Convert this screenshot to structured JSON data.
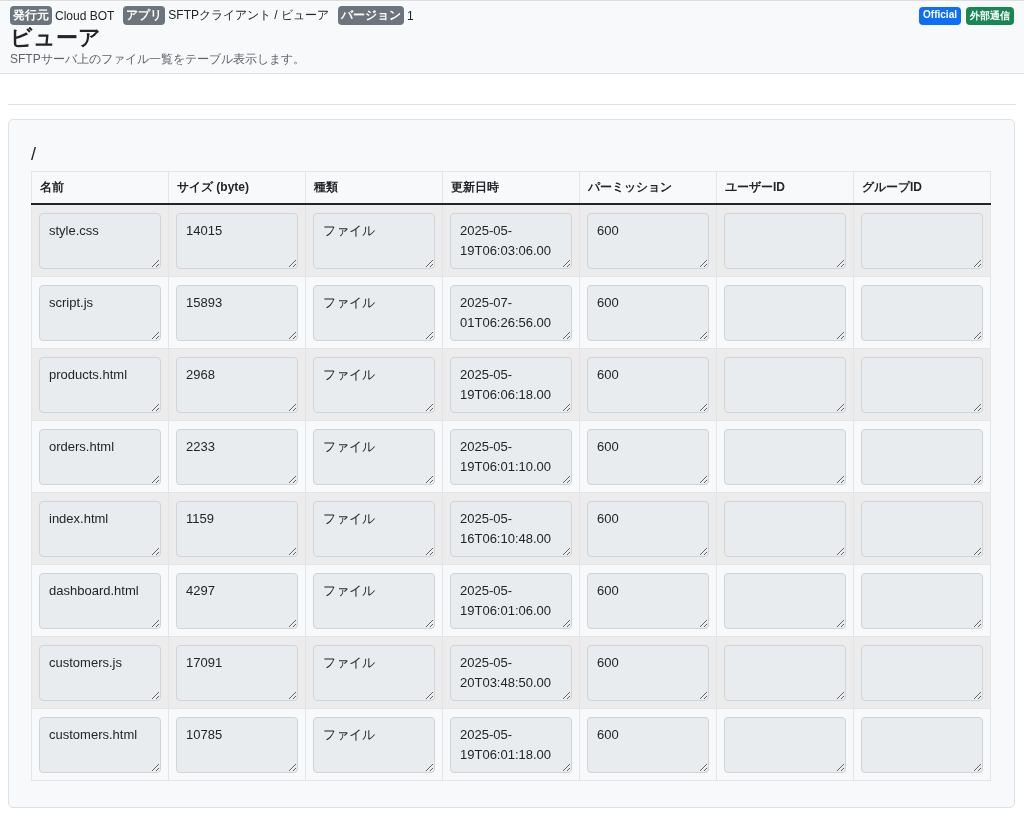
{
  "meta": [
    {
      "badge": "発行元",
      "value": "Cloud BOT"
    },
    {
      "badge": "アプリ",
      "value": "SFTPクライアント / ビューア"
    },
    {
      "badge": "バージョン",
      "value": "1"
    }
  ],
  "tags": [
    {
      "label": "Official",
      "color": "#0d6efd"
    },
    {
      "label": "外部通信",
      "color": "#198754"
    }
  ],
  "title": "ビューア",
  "subtitle": "SFTPサーバ上のファイル一覧をテーブル表示します。",
  "path": "/",
  "table": {
    "columns": [
      "名前",
      "サイズ (byte)",
      "種類",
      "更新日時",
      "パーミッション",
      "ユーザーID",
      "グループID"
    ],
    "rows": [
      {
        "cells": [
          "style.css",
          "14015",
          "ファイル",
          "2025-05-19T06:03:06.00",
          "600"
        ]
      },
      {
        "cells": [
          "script.js",
          "15893",
          "ファイル",
          "2025-07-01T06:26:56.00",
          "600"
        ]
      },
      {
        "cells": [
          "products.html",
          "2968",
          "ファイル",
          "2025-05-19T06:06:18.00",
          "600"
        ]
      },
      {
        "cells": [
          "orders.html",
          "2233",
          "ファイル",
          "2025-05-19T06:01:10.00",
          "600"
        ]
      },
      {
        "cells": [
          "index.html",
          "1159",
          "ファイル",
          "2025-05-16T06:10:48.00",
          "600"
        ]
      },
      {
        "cells": [
          "dashboard.html",
          "4297",
          "ファイル",
          "2025-05-19T06:01:06.00",
          "600"
        ]
      },
      {
        "cells": [
          "customers.js",
          "17091",
          "ファイル",
          "2025-05-20T03:48:50.00",
          "600"
        ]
      },
      {
        "cells": [
          "customers.html",
          "10785",
          "ファイル",
          "2025-05-19T06:01:18.00",
          "600"
        ]
      }
    ]
  }
}
